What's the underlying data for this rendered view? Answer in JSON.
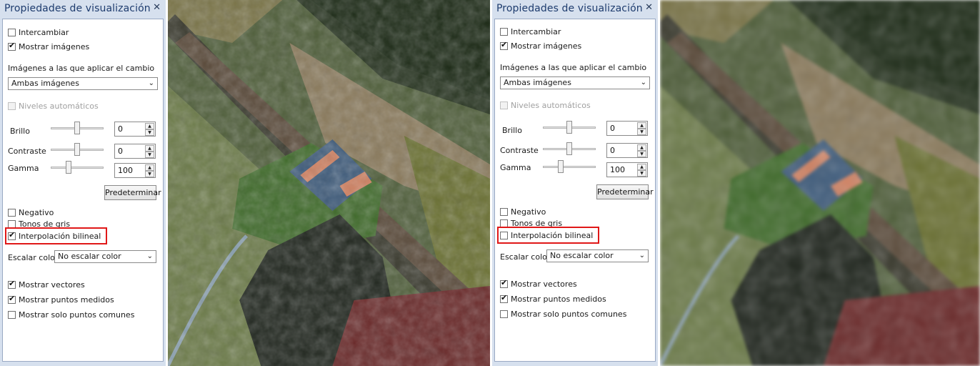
{
  "panel": {
    "title": "Propiedades de visualización",
    "close_icon": "close-icon",
    "intercambiar": "Intercambiar",
    "mostrar_imagenes": "Mostrar imágenes",
    "aplicar_label": "Imágenes a las que aplicar el cambio",
    "aplicar_value": "Ambas imágenes",
    "niveles": "Niveles automáticos",
    "brillo_label": "Brillo",
    "brillo_value": "0",
    "contraste_label": "Contraste",
    "contraste_value": "0",
    "gamma_label": "Gamma",
    "gamma_value": "100",
    "predeterminar": "Predeterminar",
    "negativo": "Negativo",
    "tonos_gris": "Tonos de gris",
    "interpolacion": "Interpolación bilineal",
    "escalar_label": "Escalar color",
    "escalar_value": "No escalar color",
    "mostrar_vectores": "Mostrar vectores",
    "mostrar_puntos": "Mostrar puntos medidos",
    "mostrar_solo": "Mostrar solo puntos comunes"
  },
  "left_state": {
    "intercambiar": false,
    "mostrar_imagenes": true,
    "negativo": false,
    "tonos_gris": false,
    "interpolacion": true,
    "mostrar_vectores": true,
    "mostrar_puntos": true,
    "mostrar_solo": false
  },
  "right_state": {
    "intercambiar": false,
    "mostrar_imagenes": true,
    "negativo": false,
    "tonos_gris": false,
    "interpolacion": false,
    "mostrar_vectores": true,
    "mostrar_puntos": true,
    "mostrar_solo": false
  },
  "colors": {
    "highlight": "#e01818",
    "panel_bg": "#d6e0ee",
    "title_text": "#1e3c6e"
  }
}
